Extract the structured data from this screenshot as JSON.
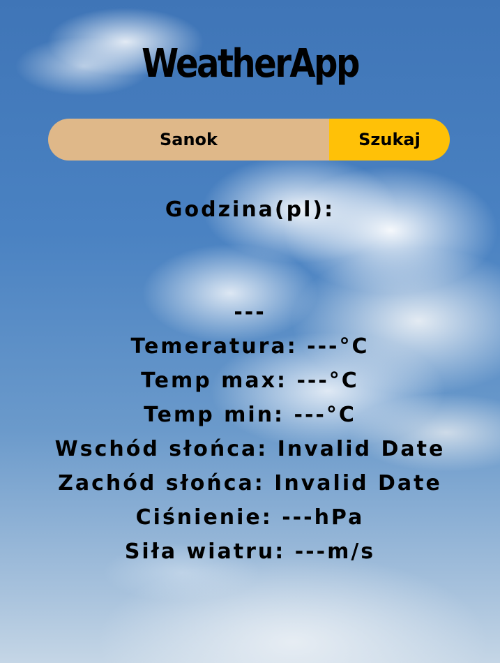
{
  "app": {
    "title": "WeatherApp"
  },
  "search": {
    "value": "Sanok",
    "button_label": "Szukaj"
  },
  "weather": {
    "time_label": "Godzina(pl):",
    "time_value": "---",
    "temperature": "Temeratura: ---°C",
    "temp_max": "Temp max: ---°C",
    "temp_min": "Temp min: ---°C",
    "sunrise": "Wschód słońca: Invalid Date",
    "sunset": "Zachód słońca: Invalid Date",
    "pressure": "Ciśnienie: ---hPa",
    "wind": "Siła wiatru: ---m/s"
  },
  "colors": {
    "input_bg": "#dfb889",
    "button_bg": "#ffc107",
    "sky": "#4a82c2"
  }
}
